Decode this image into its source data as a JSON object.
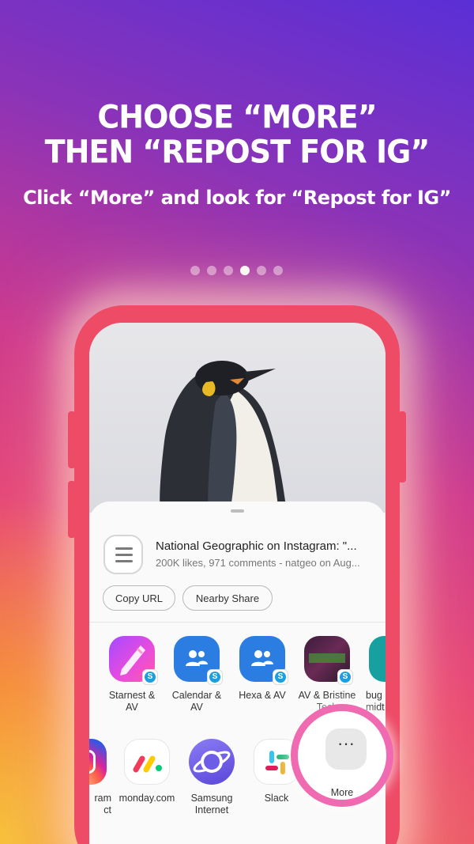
{
  "headline": {
    "line1": "CHOOSE “MORE”",
    "line2": "THEN “REPOST FOR IG”"
  },
  "subline": "Click “More” and look for “Repost for IG”",
  "pagination": {
    "count": 6,
    "active_index": 3
  },
  "share_sheet": {
    "title": "National Geographic on Instagram: \"...",
    "subtitle": "200K likes, 971 comments - natgeo on Aug...",
    "chips": [
      "Copy URL",
      "Nearby Share"
    ],
    "row1": [
      {
        "label": "Starnest &\nAV",
        "icon": "starnest-app-icon"
      },
      {
        "label": "Calendar &\nAV",
        "icon": "skype-contact-icon"
      },
      {
        "label": "Hexa & AV",
        "icon": "skype-contact-icon"
      },
      {
        "label": "AV & Bristine\nTech",
        "icon": "contact-photo-icon"
      },
      {
        "label": "bug\nmidt",
        "icon": "contact-photo-icon"
      }
    ],
    "row2": [
      {
        "label": "ram\nct",
        "icon": "instagram-icon"
      },
      {
        "label": "monday.com",
        "icon": "monday-icon"
      },
      {
        "label": "Samsung\nInternet",
        "icon": "samsung-internet-icon"
      },
      {
        "label": "Slack",
        "icon": "slack-icon"
      }
    ],
    "more_label": "More"
  },
  "colors": {
    "accent_ring": "#ef6ab0",
    "phone_frame": "#ee4b67",
    "skype_blue": "#1a9fe0",
    "contact_blue": "#2b7de1"
  }
}
